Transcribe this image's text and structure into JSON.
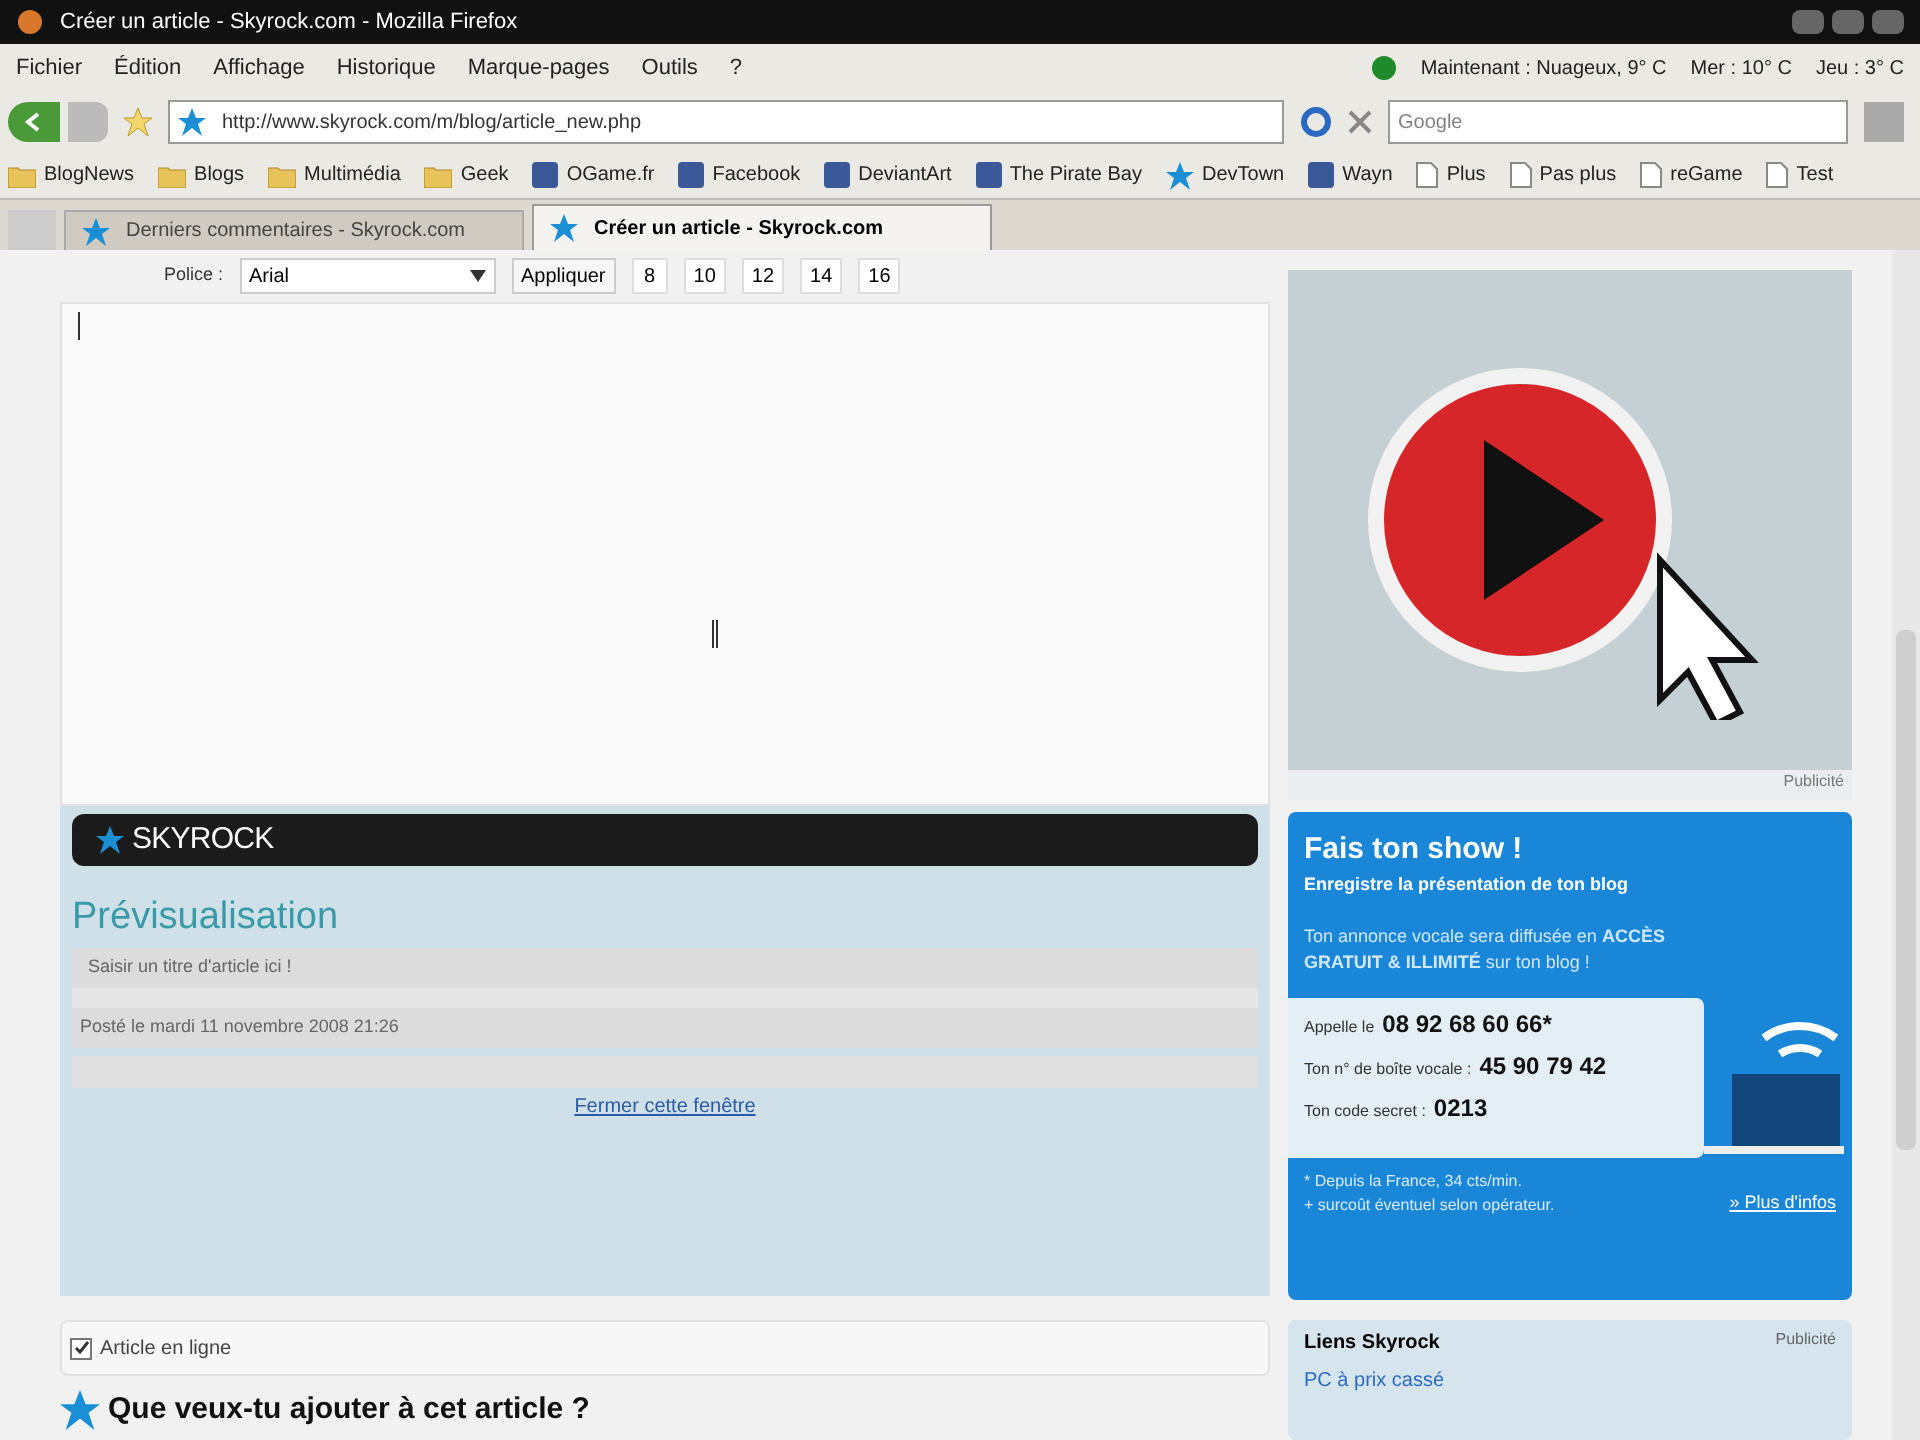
{
  "window": {
    "title": "Créer un article - Skyrock.com - Mozilla Firefox"
  },
  "menu": [
    "Fichier",
    "Édition",
    "Affichage",
    "Historique",
    "Marque-pages",
    "Outils",
    "?"
  ],
  "weather": [
    "Maintenant : Nuageux, 9° C",
    "Mer : 10° C",
    "Jeu : 3° C"
  ],
  "address": {
    "value": "http://www.skyrock.com/m/blog/article_new.php"
  },
  "search": {
    "placeholder": "Google"
  },
  "bookmarks": [
    {
      "label": "BlogNews",
      "kind": "folder"
    },
    {
      "label": "Blogs",
      "kind": "folder"
    },
    {
      "label": "Multimédia",
      "kind": "folder"
    },
    {
      "label": "Geek",
      "kind": "folder"
    },
    {
      "label": "OGame.fr",
      "kind": "site"
    },
    {
      "label": "Facebook",
      "kind": "site"
    },
    {
      "label": "DeviantArt",
      "kind": "site"
    },
    {
      "label": "The Pirate Bay",
      "kind": "site"
    },
    {
      "label": "DevTown",
      "kind": "star"
    },
    {
      "label": "Wayn",
      "kind": "site"
    },
    {
      "label": "Plus",
      "kind": "page"
    },
    {
      "label": "Pas plus",
      "kind": "page"
    },
    {
      "label": "reGame",
      "kind": "page"
    },
    {
      "label": "Test",
      "kind": "page"
    }
  ],
  "tabs": [
    {
      "label": "Derniers commentaires - Skyrock.com",
      "selected": false
    },
    {
      "label": "Créer un article - Skyrock.com",
      "selected": true
    }
  ],
  "editor": {
    "font_label": "Police :",
    "font_value": "Arial",
    "apply": "Appliquer",
    "sizes": [
      "8",
      "10",
      "12",
      "14",
      "16"
    ]
  },
  "preview": {
    "logo": "SKYROCK",
    "heading": "Prévisualisation",
    "title_hint": "Saisir un titre d'article ici !",
    "posted": "Posté le mardi 11 novembre 2008 21:26",
    "close_link": "Fermer cette fenêtre"
  },
  "ad": {
    "caption": "Publicité"
  },
  "promo": {
    "title": "Fais ton show !",
    "subtitle": "Enregistre la présentation de ton blog",
    "body": "Ton annonce vocale sera diffusée en **ACCÈS GRATUIT & ILLIMITÉ** sur ton blog !",
    "lines": [
      {
        "label": "Appelle le",
        "value": "08 92 68 60 66*"
      },
      {
        "label": "Ton n° de boîte vocale :",
        "value": "45 90 79 42"
      },
      {
        "label": "Ton code secret :",
        "value": "0213"
      }
    ],
    "notes": [
      "* Depuis la France, 34 cts/min.",
      "+ surcoût éventuel selon opérateur."
    ],
    "link": "» Plus d'infos"
  },
  "online": {
    "label": "Article en ligne",
    "checked": true
  },
  "add_heading": "Que veux-tu ajouter à cet article ?",
  "links_box": {
    "title": "Liens Skyrock",
    "tag": "Publicité",
    "items": [
      "PC à prix cassé"
    ]
  }
}
